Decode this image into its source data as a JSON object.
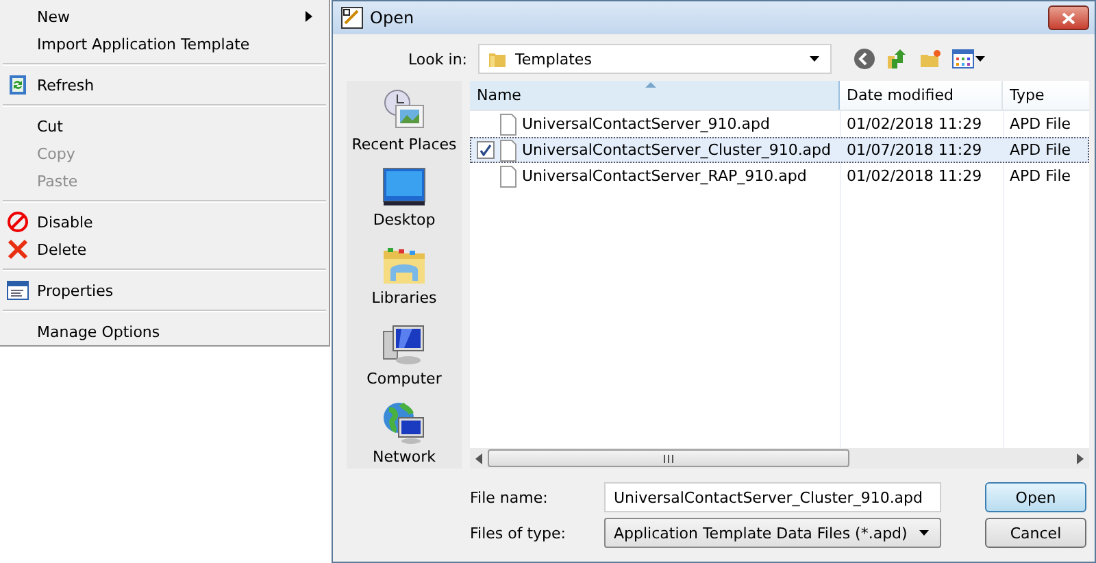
{
  "context_menu": {
    "items": [
      {
        "kind": "item",
        "label": "New",
        "disabled": false,
        "submenu": true
      },
      {
        "kind": "item",
        "label": "Import Application Template",
        "disabled": false,
        "submenu": false
      },
      {
        "kind": "separator"
      },
      {
        "kind": "item",
        "label": "Refresh",
        "disabled": false,
        "submenu": false
      },
      {
        "kind": "separator"
      },
      {
        "kind": "item",
        "label": "Cut",
        "disabled": false,
        "submenu": false
      },
      {
        "kind": "item",
        "label": "Copy",
        "disabled": true,
        "submenu": false
      },
      {
        "kind": "item",
        "label": "Paste",
        "disabled": true,
        "submenu": false
      },
      {
        "kind": "separator"
      },
      {
        "kind": "item",
        "label": "Disable",
        "disabled": false,
        "submenu": false
      },
      {
        "kind": "item",
        "label": "Delete",
        "disabled": false,
        "submenu": false
      },
      {
        "kind": "separator"
      },
      {
        "kind": "item",
        "label": "Properties",
        "disabled": false,
        "submenu": false
      },
      {
        "kind": "separator"
      },
      {
        "kind": "item",
        "label": "Manage Options",
        "disabled": false,
        "submenu": false
      }
    ]
  },
  "window": {
    "title": "Open"
  },
  "look_in": {
    "label": "Look in:",
    "value": "Templates"
  },
  "places": [
    {
      "label": "Recent Places"
    },
    {
      "label": "Desktop"
    },
    {
      "label": "Libraries"
    },
    {
      "label": "Computer"
    },
    {
      "label": "Network"
    }
  ],
  "table": {
    "columns": [
      "Name",
      "Date modified",
      "Type"
    ],
    "rows": [
      {
        "name": "UniversalContactServer_910.apd",
        "date": "01/02/2018 11:29",
        "type": "APD File",
        "selected": false,
        "checked": false
      },
      {
        "name": "UniversalContactServer_Cluster_910.apd",
        "date": "01/07/2018 11:29",
        "type": "APD File",
        "selected": true,
        "checked": true
      },
      {
        "name": "UniversalContactServer_RAP_910.apd",
        "date": "01/02/2018 11:29",
        "type": "APD File",
        "selected": false,
        "checked": false
      }
    ]
  },
  "file_name": {
    "label": "File name:",
    "value": "UniversalContactServer_Cluster_910.apd"
  },
  "file_type": {
    "label": "Files of type:",
    "value": "Application Template Data Files (*.apd)"
  },
  "buttons": [
    "Open",
    "Cancel"
  ]
}
